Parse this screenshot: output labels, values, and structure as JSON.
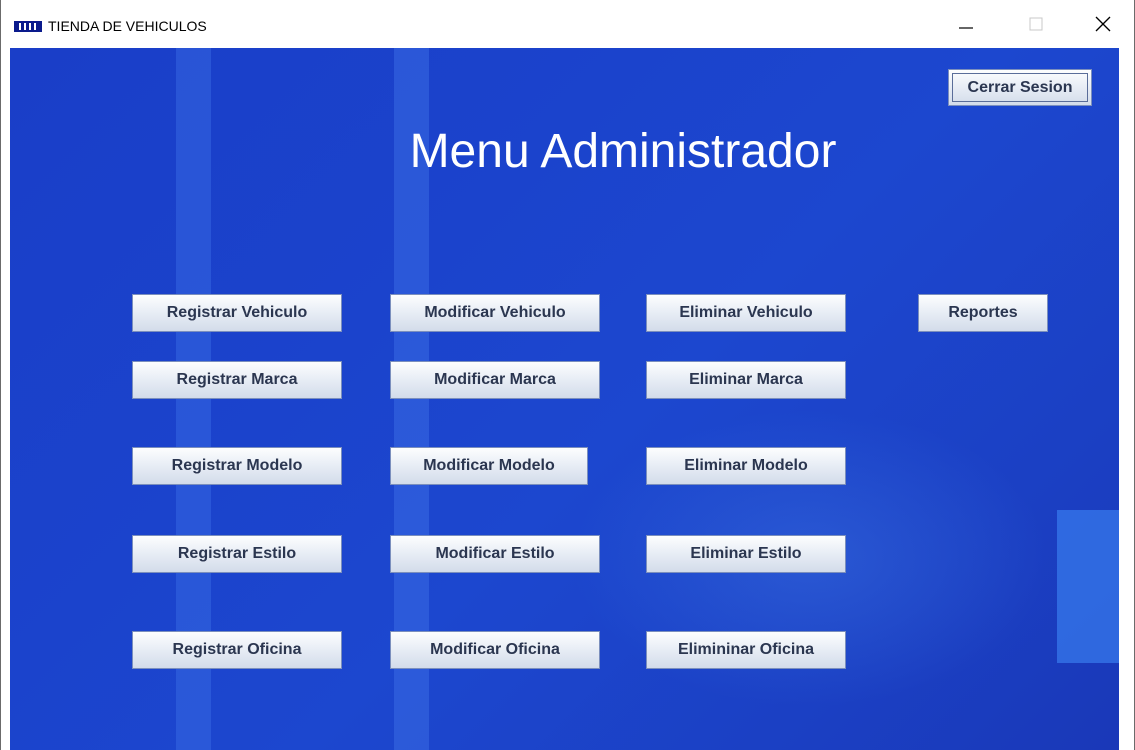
{
  "window": {
    "title": "TIENDA DE VEHICULOS",
    "controls": {
      "minimize": "—",
      "maximize": "☐",
      "close": "✕"
    }
  },
  "header": {
    "logout_label": "Cerrar Sesion",
    "title": "Menu Administrador"
  },
  "menu": {
    "vehiculo": {
      "register": "Registrar Vehiculo",
      "modify": "Modificar Vehiculo",
      "delete": "Eliminar Vehiculo"
    },
    "reports": "Reportes",
    "marca": {
      "register": "Registrar Marca",
      "modify": "Modificar Marca",
      "delete": "Eliminar Marca"
    },
    "modelo": {
      "register": "Registrar Modelo",
      "modify": "Modificar Modelo",
      "delete": "Eliminar Modelo"
    },
    "estilo": {
      "register": "Registrar Estilo",
      "modify": "Modificar Estilo",
      "delete": "Eliminar Estilo"
    },
    "oficina": {
      "register": "Registrar Oficina",
      "modify": "Modificar Oficina",
      "delete": "Elimininar Oficina"
    }
  },
  "colors": {
    "background": "#1b43cc",
    "heading": "#ffffff",
    "button_text": "#2b3650"
  },
  "icons": {
    "app": "java-app-icon",
    "minimize": "minimize-icon",
    "maximize": "maximize-icon",
    "close": "close-icon"
  }
}
